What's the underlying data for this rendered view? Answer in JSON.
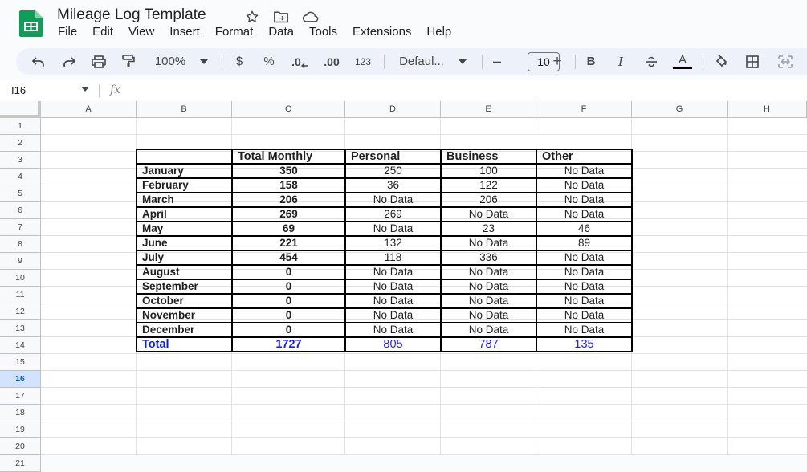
{
  "doc": {
    "title": "Mileage Log Template",
    "menu": [
      "File",
      "Edit",
      "View",
      "Insert",
      "Format",
      "Data",
      "Tools",
      "Extensions",
      "Help"
    ]
  },
  "toolbar": {
    "zoom": "100%",
    "currency": "$",
    "percent": "%",
    "dec_decrease": ".0",
    "dec_increase": ".00",
    "number_format": "123",
    "font": "Defaul...",
    "minus": "–",
    "font_size": "10",
    "plus": "+",
    "bold": "B",
    "italic": "I",
    "text_color": "A"
  },
  "formula_bar": {
    "cell_ref": "I16",
    "fx": "fx"
  },
  "grid": {
    "columns": [
      "A",
      "B",
      "C",
      "D",
      "E",
      "F",
      "G",
      "H"
    ],
    "rows": [
      "1",
      "2",
      "3",
      "4",
      "5",
      "6",
      "7",
      "8",
      "9",
      "10",
      "11",
      "12",
      "13",
      "14",
      "15",
      "16",
      "17",
      "18",
      "19",
      "20",
      "21"
    ],
    "selected_row": "16"
  },
  "table": {
    "headers": [
      "",
      "Total Monthly",
      "Personal",
      "Business",
      "Other"
    ],
    "rows": [
      [
        "January",
        "350",
        "250",
        "100",
        "No Data"
      ],
      [
        "February",
        "158",
        "36",
        "122",
        "No Data"
      ],
      [
        "March",
        "206",
        "No Data",
        "206",
        "No Data"
      ],
      [
        "April",
        "269",
        "269",
        "No Data",
        "No Data"
      ],
      [
        "May",
        "69",
        "No Data",
        "23",
        "46"
      ],
      [
        "June",
        "221",
        "132",
        "No Data",
        "89"
      ],
      [
        "July",
        "454",
        "118",
        "336",
        "No Data"
      ],
      [
        "August",
        "0",
        "No Data",
        "No Data",
        "No Data"
      ],
      [
        "September",
        "0",
        "No Data",
        "No Data",
        "No Data"
      ],
      [
        "October",
        "0",
        "No Data",
        "No Data",
        "No Data"
      ],
      [
        "November",
        "0",
        "No Data",
        "No Data",
        "No Data"
      ],
      [
        "December",
        "0",
        "No Data",
        "No Data",
        "No Data"
      ]
    ],
    "total": [
      "Total",
      "1727",
      "805",
      "787",
      "135"
    ]
  },
  "colors": {
    "sheets_green": "#0f9d58",
    "total_blue": "#1a1aff",
    "selected_row": "#d3e3fd"
  }
}
